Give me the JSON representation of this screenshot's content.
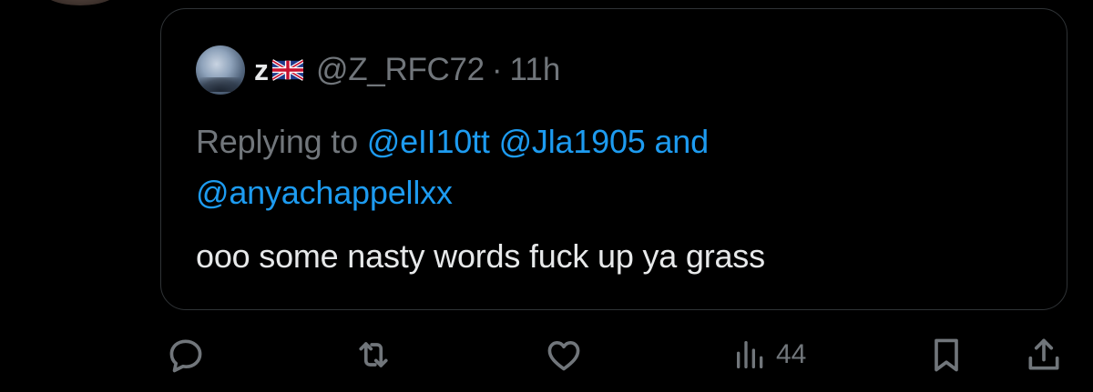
{
  "quoted_tweet": {
    "display_name": "z",
    "handle": "@Z_RFC72",
    "separator": "·",
    "time": "11h",
    "replying_prefix": "Replying to",
    "mentions": [
      "@eII10tt",
      "@Jla1905"
    ],
    "and_word": "and",
    "last_mention": "@anyachappellxx",
    "text": "ooo some nasty words fuck up ya grass"
  },
  "actions": {
    "reply_icon": "reply-icon",
    "retweet_icon": "retweet-icon",
    "like_icon": "heart-icon",
    "views_icon": "views-icon",
    "views_count": "44",
    "bookmark_icon": "bookmark-icon",
    "share_icon": "share-icon"
  },
  "colors": {
    "background": "#000000",
    "text_primary": "#e7e9ea",
    "text_secondary": "#71767b",
    "link": "#1d9bf0",
    "border": "#2f3336"
  }
}
